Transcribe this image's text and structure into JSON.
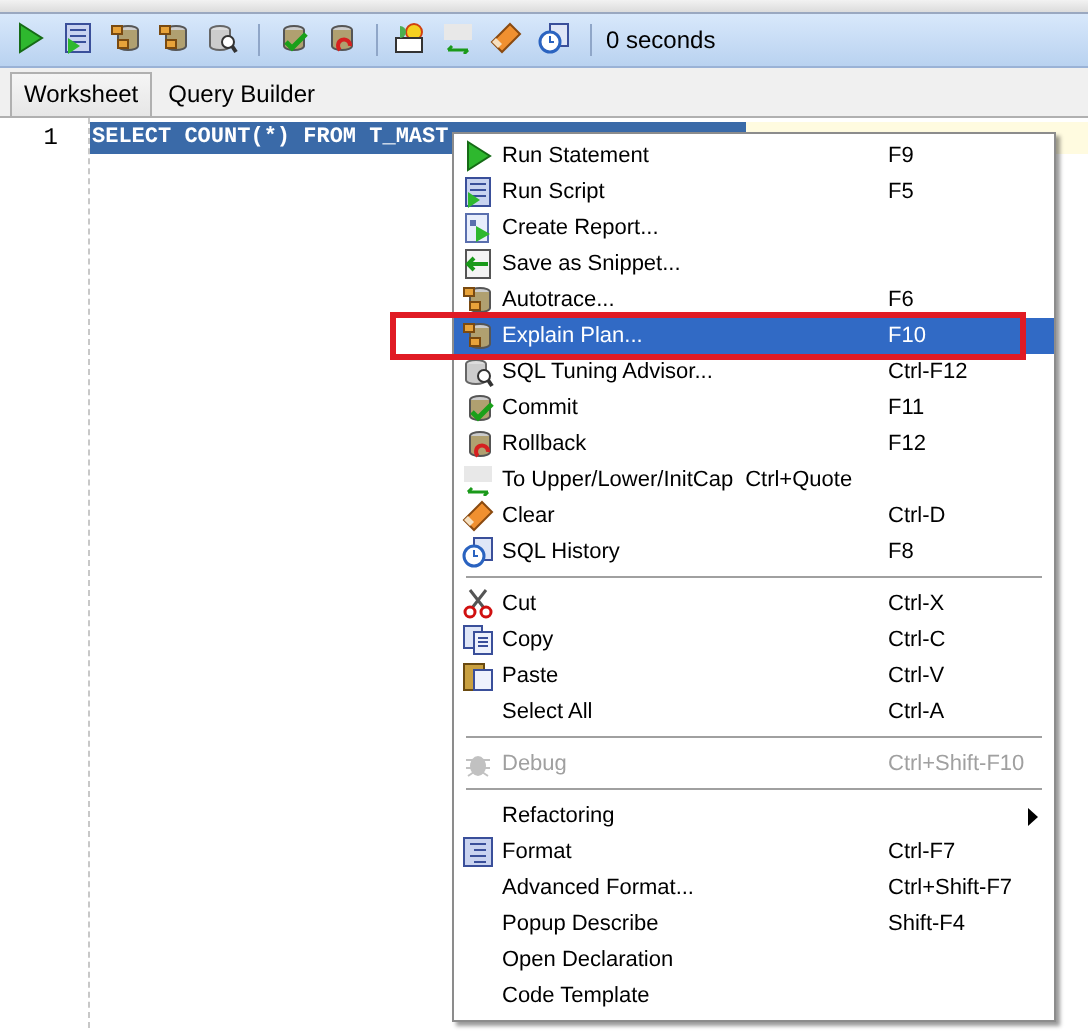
{
  "toolbar": {
    "elapsed": "0 seconds"
  },
  "tabs": [
    {
      "label": "Worksheet",
      "selected": true
    },
    {
      "label": "Query Builder",
      "selected": false
    }
  ],
  "editor": {
    "line_number": "1",
    "code": "SELECT COUNT(*) FROM T_MAST",
    "selected": true
  },
  "context_menu": {
    "items": [
      {
        "kind": "item",
        "label": "Run Statement",
        "shortcut": "F9",
        "selected": false,
        "disabled": false
      },
      {
        "kind": "item",
        "label": "Run Script",
        "shortcut": "F5",
        "selected": false,
        "disabled": false
      },
      {
        "kind": "item",
        "label": "Create Report...",
        "selected": false,
        "disabled": false
      },
      {
        "kind": "item",
        "label": "Save as Snippet...",
        "selected": false,
        "disabled": false
      },
      {
        "kind": "item",
        "label": "Autotrace...",
        "shortcut": "F6",
        "selected": false,
        "disabled": false
      },
      {
        "kind": "item",
        "label": "Explain Plan...",
        "shortcut": "F10",
        "selected": true,
        "disabled": false,
        "highlighted": true
      },
      {
        "kind": "item",
        "label": "SQL Tuning Advisor...",
        "shortcut": "Ctrl-F12",
        "selected": false,
        "disabled": false
      },
      {
        "kind": "item",
        "label": "Commit",
        "shortcut": "F11",
        "selected": false,
        "disabled": false
      },
      {
        "kind": "item",
        "label": "Rollback",
        "shortcut": "F12",
        "selected": false,
        "disabled": false
      },
      {
        "kind": "inline",
        "label": "To Upper/Lower/InitCap",
        "shortcut": "Ctrl+Quote",
        "selected": false,
        "disabled": false
      },
      {
        "kind": "item",
        "label": "Clear",
        "shortcut": "Ctrl-D",
        "selected": false,
        "disabled": false
      },
      {
        "kind": "item",
        "label": "SQL History",
        "shortcut": "F8",
        "selected": false,
        "disabled": false
      },
      {
        "kind": "separator"
      },
      {
        "kind": "item",
        "label": "Cut",
        "shortcut": "Ctrl-X",
        "selected": false,
        "disabled": false
      },
      {
        "kind": "item",
        "label": "Copy",
        "shortcut": "Ctrl-C",
        "selected": false,
        "disabled": false
      },
      {
        "kind": "item",
        "label": "Paste",
        "shortcut": "Ctrl-V",
        "selected": false,
        "disabled": false
      },
      {
        "kind": "item",
        "label": "Select All",
        "shortcut": "Ctrl-A",
        "selected": false,
        "disabled": false
      },
      {
        "kind": "separator"
      },
      {
        "kind": "item",
        "label": "Debug",
        "shortcut": "Ctrl+Shift-F10",
        "selected": false,
        "disabled": true
      },
      {
        "kind": "separator"
      },
      {
        "kind": "submenu",
        "label": "Refactoring",
        "selected": false,
        "disabled": false
      },
      {
        "kind": "item",
        "label": "Format",
        "shortcut": "Ctrl-F7",
        "selected": false,
        "disabled": false
      },
      {
        "kind": "item",
        "label": "Advanced Format...",
        "shortcut": "Ctrl+Shift-F7",
        "selected": false,
        "disabled": false
      },
      {
        "kind": "item",
        "label": "Popup Describe",
        "shortcut": "Shift-F4",
        "selected": false,
        "disabled": false
      },
      {
        "kind": "item",
        "label": "Open Declaration",
        "selected": false,
        "disabled": false
      },
      {
        "kind": "item",
        "label": "Code Template",
        "selected": false,
        "disabled": false
      }
    ]
  }
}
